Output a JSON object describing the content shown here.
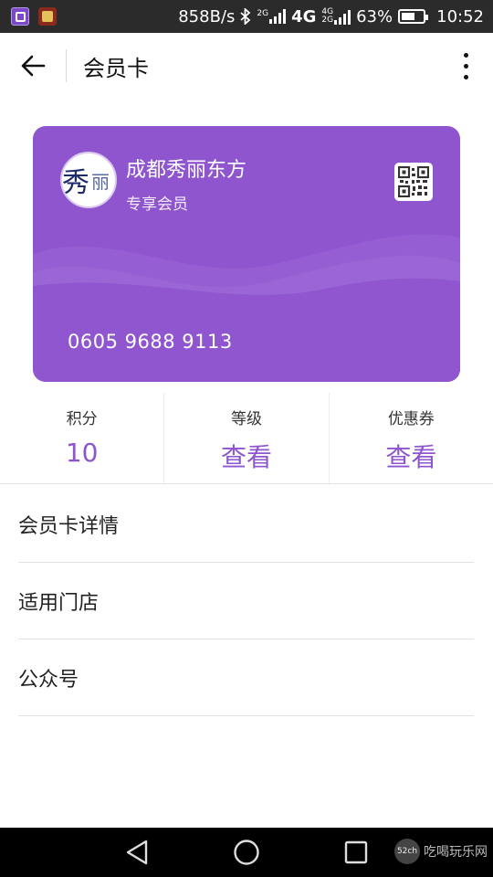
{
  "status_bar": {
    "speed": "858B/s",
    "net_2g": "2G",
    "net_4g": "4G",
    "net_4g_small": "4G",
    "net_2g_small": "2G",
    "battery": "63%",
    "time": "10:52"
  },
  "header": {
    "title": "会员卡"
  },
  "card": {
    "merchant_name": "成都秀丽东方",
    "level": "专享会员",
    "logo_chars": [
      "秀",
      "丽"
    ],
    "number": "0605 9688 9113",
    "accent_color": "#8e55cf"
  },
  "stats": [
    {
      "label": "积分",
      "value": "10"
    },
    {
      "label": "等级",
      "value": "查看"
    },
    {
      "label": "优惠券",
      "value": "查看"
    }
  ],
  "menu": [
    {
      "label": "会员卡详情"
    },
    {
      "label": "适用门店"
    },
    {
      "label": "公众号"
    }
  ],
  "watermark": {
    "badge": "52ch",
    "text": "吃喝玩乐网"
  }
}
